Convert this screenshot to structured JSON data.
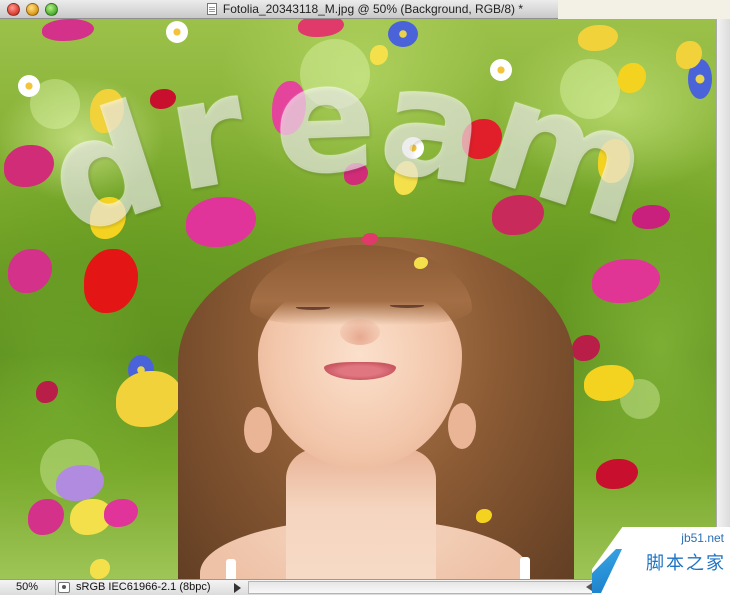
{
  "window": {
    "title": "Fotolia_20343118_M.jpg @ 50% (Background, RGB/8) *"
  },
  "canvas": {
    "overlay_text": [
      "d",
      "r",
      "e",
      "a",
      "m"
    ]
  },
  "statusbar": {
    "zoom": "50%",
    "profile": "sRGB IEC61966-2.1 (8bpc)"
  },
  "watermark": {
    "url": "jb51.net",
    "name": "脚本之家"
  },
  "colors": {
    "titlebar": "#d6d6d6",
    "close": "#e0463a",
    "minimize": "#e3a21f",
    "maximize": "#55b737",
    "watermark_blue": "#1d73c4"
  },
  "icons": [
    "close-window-icon",
    "minimize-window-icon",
    "maximize-window-icon",
    "document-icon",
    "document-status-icon",
    "play-arrow-icon"
  ]
}
